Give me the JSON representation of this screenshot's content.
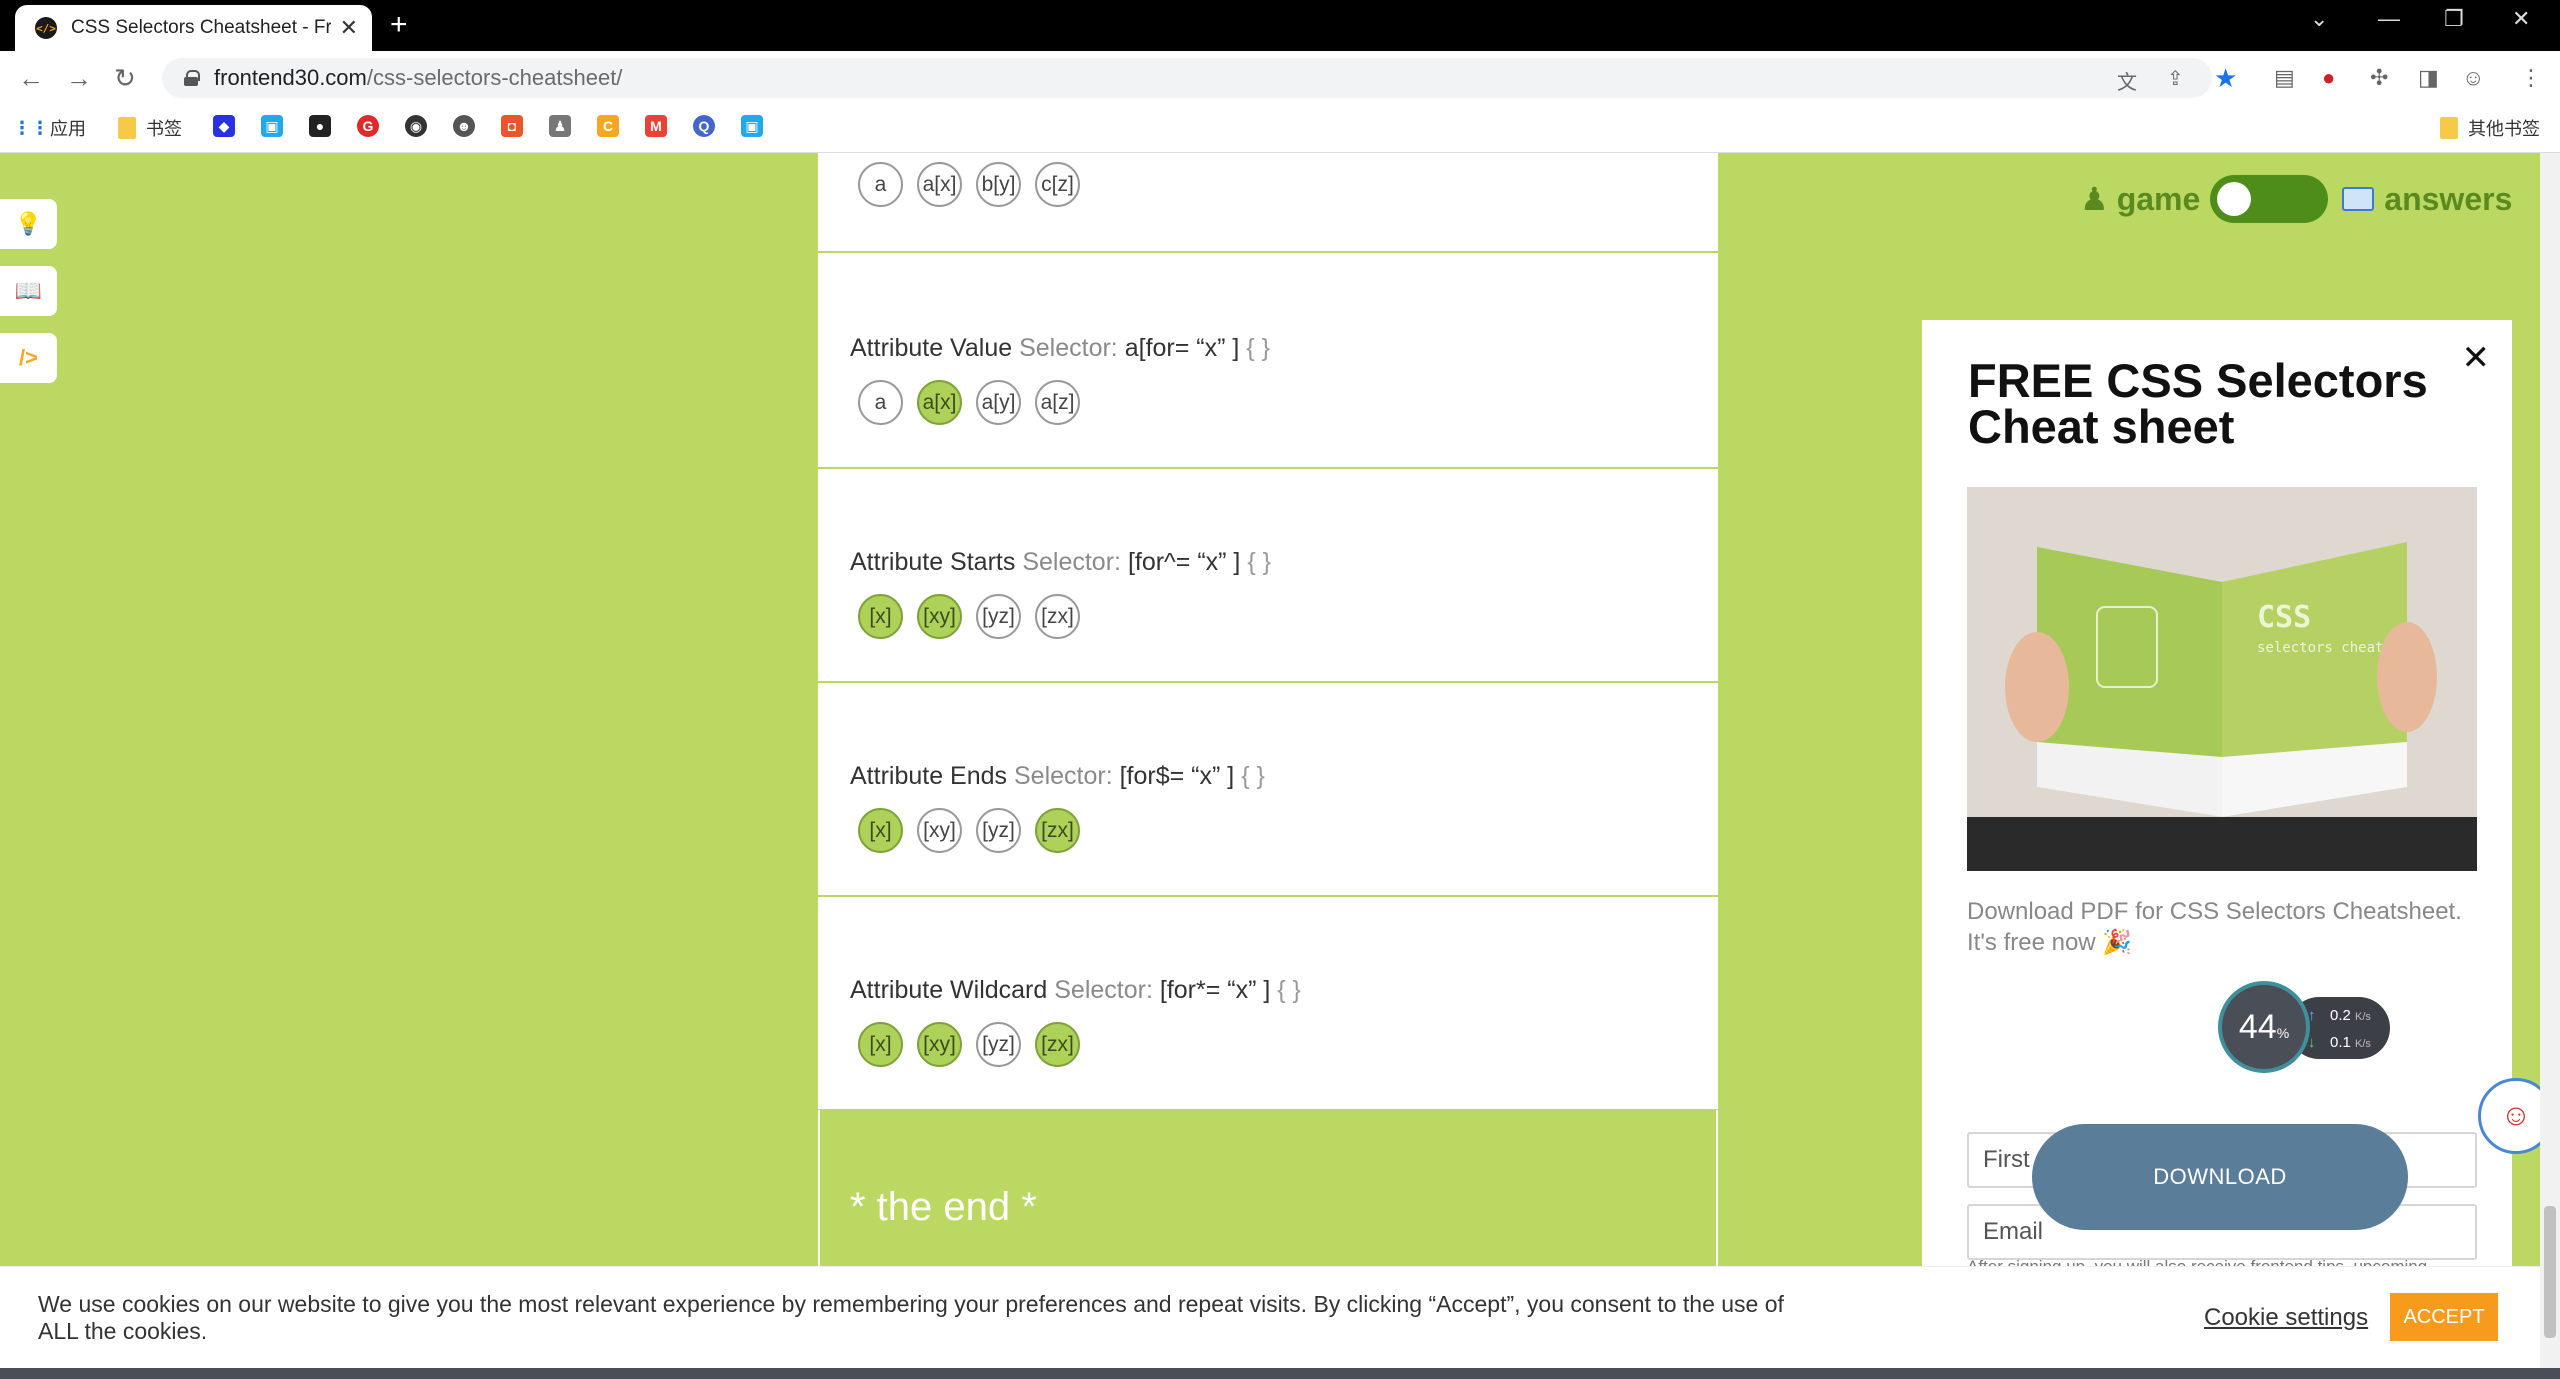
{
  "browser": {
    "tab_title": "CSS Selectors Cheatsheet - Fro",
    "url_host": "frontend30.com",
    "url_path": "/css-selectors-cheatsheet/",
    "bookmarks": [
      "应用",
      "书签"
    ],
    "other_bookmarks": "其他书签"
  },
  "toolbar": {
    "game_label": "game",
    "answers_label": "answers",
    "game_mode_on": false
  },
  "first_card": {
    "chips": [
      {
        "label": "a",
        "on": false
      },
      {
        "label": "a[x]",
        "on": false
      },
      {
        "label": "b[y]",
        "on": false
      },
      {
        "label": "c[z]",
        "on": false
      }
    ]
  },
  "selectors": [
    {
      "name": "Attribute Value",
      "suffix": "Selector:",
      "code": "a[for= “x” ]",
      "braces": "{ }",
      "chips": [
        {
          "label": "a",
          "on": false
        },
        {
          "label": "a[x]",
          "on": true
        },
        {
          "label": "a[y]",
          "on": false
        },
        {
          "label": "a[z]",
          "on": false
        }
      ]
    },
    {
      "name": "Attribute Starts",
      "suffix": "Selector:",
      "code": "[for^= “x” ]",
      "braces": "{ }",
      "chips": [
        {
          "label": "[x]",
          "on": true
        },
        {
          "label": "[xy]",
          "on": true
        },
        {
          "label": "[yz]",
          "on": false
        },
        {
          "label": "[zx]",
          "on": false
        }
      ]
    },
    {
      "name": "Attribute Ends",
      "suffix": "Selector:",
      "code": "[for$= “x” ]",
      "braces": "{ }",
      "chips": [
        {
          "label": "[x]",
          "on": true
        },
        {
          "label": "[xy]",
          "on": false
        },
        {
          "label": "[yz]",
          "on": false
        },
        {
          "label": "[zx]",
          "on": true
        }
      ]
    },
    {
      "name": "Attribute Wildcard",
      "suffix": "Selector:",
      "code": "[for*= “x” ]",
      "braces": "{ }",
      "chips": [
        {
          "label": "[x]",
          "on": true
        },
        {
          "label": "[xy]",
          "on": true
        },
        {
          "label": "[yz]",
          "on": false
        },
        {
          "label": "[zx]",
          "on": true
        }
      ]
    }
  ],
  "end_text": "* the end *",
  "modal": {
    "title": "FREE CSS Selectors Cheat sheet",
    "book_cover_title": "CSS",
    "book_cover_sub": "selectors cheatsheet",
    "description": "Download PDF for CSS Selectors Cheatsheet. It's free now 🎉",
    "first_name_placeholder": "First name",
    "email_placeholder": "Email",
    "download_label": "DOWNLOAD",
    "small_print": "After signing up, you will also receive frontend tips, upcoming"
  },
  "speed_widget": {
    "percent": "44",
    "unit": "%",
    "upload": "0.2",
    "download": "0.1",
    "rate_unit": "K/s"
  },
  "cookie": {
    "text": "We use cookies on our website to give you the most relevant experience by remembering your preferences and repeat visits. By clicking “Accept”, you consent to the use of ALL the cookies.",
    "settings_label": "Cookie settings",
    "accept_label": "ACCEPT"
  },
  "colors": {
    "page_bg": "#bbd962",
    "chip_on": "#aed159",
    "accent_green": "#5a8a1f",
    "download_btn": "#5a7d99",
    "accept_btn": "#f79b1c"
  }
}
